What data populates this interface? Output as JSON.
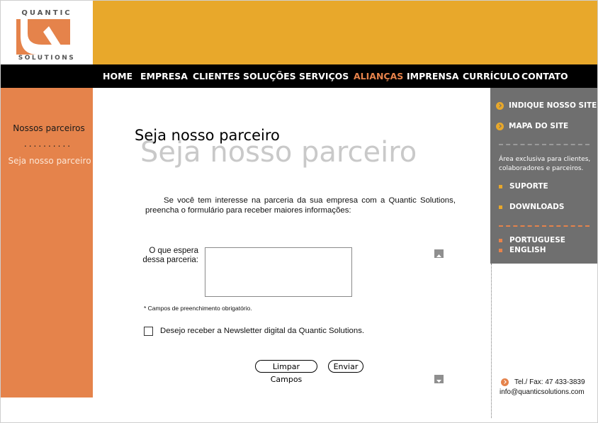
{
  "brand": {
    "logo_top": "QUANTIC",
    "logo_bottom": "SOLUTIONS",
    "logo_color": "#e5834b",
    "header_color": "#e8a82b"
  },
  "nav": {
    "items": [
      "HOME",
      "EMPRESA",
      "CLIENTES",
      "SOLUÇÕES",
      "SERVIÇOS",
      "ALIANÇAS",
      "IMPRENSA",
      "CURRÍCULO",
      "CONTATO"
    ],
    "active": "ALIANÇAS",
    "active_color": "#e8834b"
  },
  "left_sidebar": {
    "title": "Nossos parceiros",
    "dots": "..........",
    "link": "Seja nosso parceiro"
  },
  "main": {
    "title_shadow": "Seja nosso parceiro",
    "title": "Seja nosso parceiro",
    "intro": "Se você tem interesse na parceria da sua empresa com a Quantic Solutions, preencha o formulário para receber maiores informações:",
    "field_label": "O que espera dessa parceria:",
    "field_value": "",
    "required_note": "* Campos de preenchimento obrigatório.",
    "newsletter_label": "Desejo receber a Newsletter digital da Quantic Solutions.",
    "newsletter_checked": false,
    "clear_button": "Limpar Campos",
    "submit_button": "Enviar",
    "scroll_up_icon": "triangle-up-icon",
    "scroll_down_icon": "triangle-down-icon"
  },
  "right_sidebar": {
    "links_top": [
      "INDIQUE NOSSO SITE",
      "MAPA DO SITE"
    ],
    "note": "Área exclusiva para clientes, colaboradores e parceiros.",
    "links_members": [
      "SUPORTE",
      "DOWNLOADS"
    ],
    "languages": [
      "PORTUGUESE",
      "ENGLISH"
    ],
    "bullet_icon": "chevron-right-circle-icon"
  },
  "contact": {
    "phone": "Tel./ Fax: 47 433-3839",
    "email": "info@quanticsolutions.com"
  }
}
